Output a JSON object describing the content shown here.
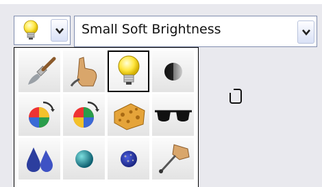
{
  "tool_selector": {
    "current_icon": "lightbulb-icon"
  },
  "brush_dropdown": {
    "selected": "Small Soft Brightness"
  },
  "brush_grid": {
    "selected_index": 2,
    "items": [
      {
        "icon": "paintbrush-icon"
      },
      {
        "icon": "finger-smudge-icon"
      },
      {
        "icon": "lightbulb-icon"
      },
      {
        "icon": "dark-sphere-icon"
      },
      {
        "icon": "color-wheel-rotate-icon"
      },
      {
        "icon": "color-wheel-rotate-alt-icon"
      },
      {
        "icon": "sponge-icon"
      },
      {
        "icon": "sunglasses-icon"
      },
      {
        "icon": "water-drops-icon"
      },
      {
        "icon": "teal-sphere-icon"
      },
      {
        "icon": "blue-sphere-icon"
      },
      {
        "icon": "hand-pen-icon"
      }
    ]
  }
}
